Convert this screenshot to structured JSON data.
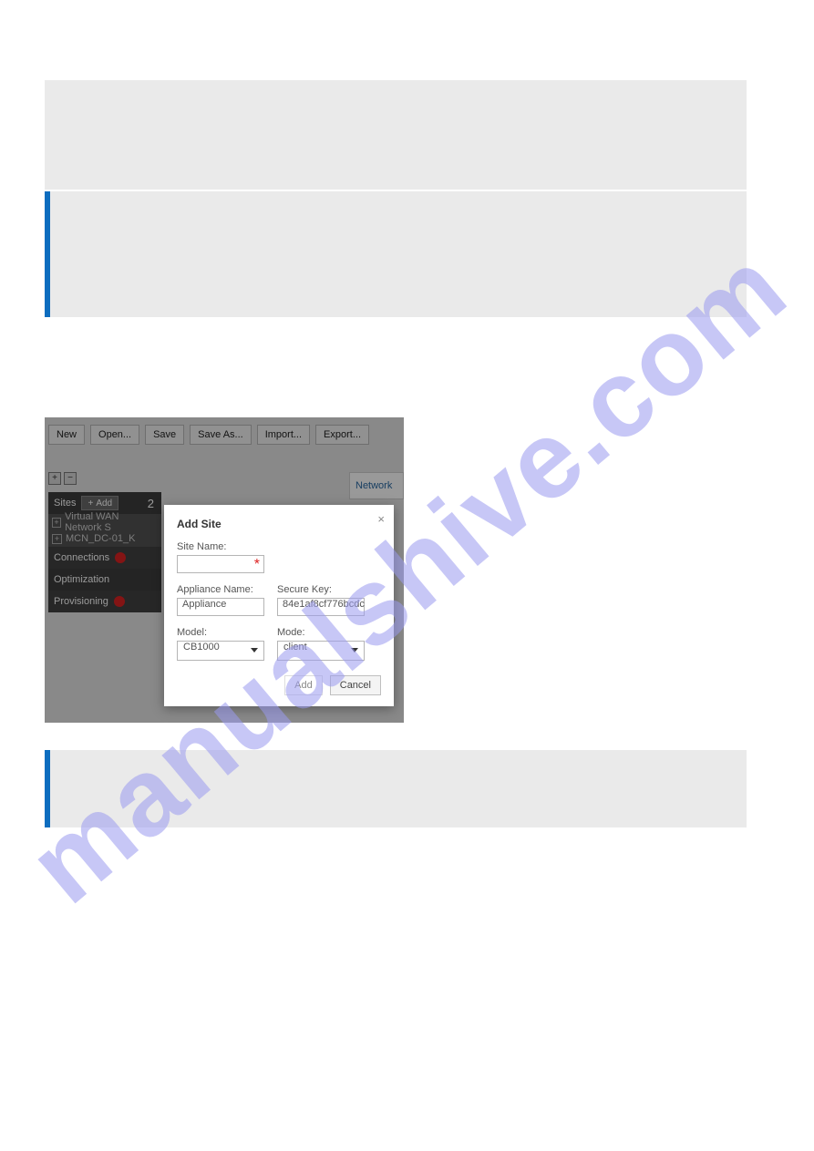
{
  "watermark": "manualshive.com",
  "toolbar": {
    "new": "New",
    "open": "Open...",
    "save": "Save",
    "save_as": "Save As...",
    "import": "Import...",
    "export": "Export..."
  },
  "tree_controls": {
    "expand": "+",
    "collapse": "−"
  },
  "panels": {
    "sites": {
      "title": "Sites",
      "add": "Add",
      "count": "2"
    },
    "items": {
      "item1": "Virtual WAN Network S",
      "item2": "MCN_DC-01_K"
    },
    "connections": "Connections",
    "optimization": "Optimization",
    "provisioning": "Provisioning"
  },
  "topright": {
    "network": "Network"
  },
  "dialog": {
    "title": "Add Site",
    "site_name_label": "Site Name:",
    "site_name_value": "",
    "appliance_name_label": "Appliance Name:",
    "appliance_name_value": "Appliance",
    "secure_key_label": "Secure Key:",
    "secure_key_value": "84e1af8cf776bcdc",
    "model_label": "Model:",
    "model_value": "CB1000",
    "mode_label": "Mode:",
    "mode_value": "client",
    "add_btn": "Add",
    "cancel_btn": "Cancel"
  }
}
